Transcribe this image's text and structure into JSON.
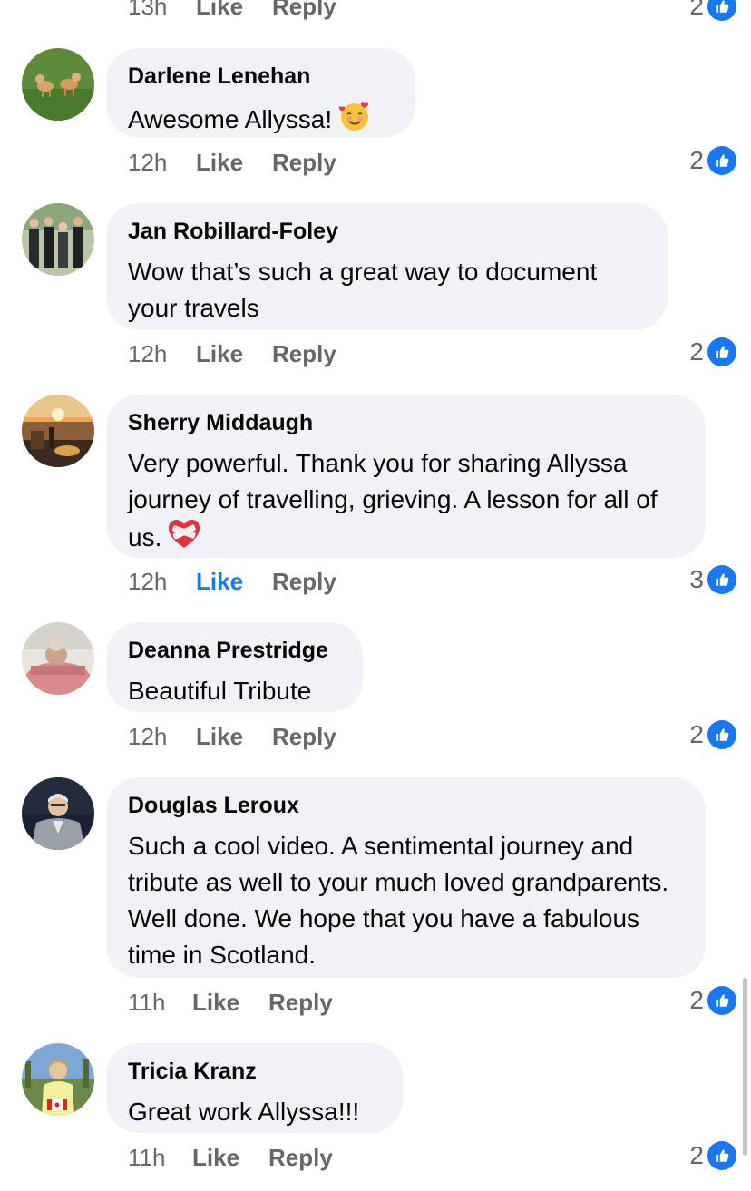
{
  "prev_meta": {
    "time": "13h",
    "like": "Like",
    "reply": "Reply",
    "count": "2"
  },
  "comments": [
    {
      "author": "Darlene Lenehan",
      "text": "Awesome Allyssa!",
      "emoji": "smiling-face-with-hearts-icon",
      "time": "12h",
      "like": "Like",
      "reply": "Reply",
      "count": "2",
      "liked": false
    },
    {
      "author": "Jan Robillard-Foley",
      "text": "Wow that’s such a great way to document your travels",
      "time": "12h",
      "like": "Like",
      "reply": "Reply",
      "count": "2",
      "liked": false
    },
    {
      "author": "Sherry Middaugh",
      "text": "Very powerful. Thank you for sharing Allyssa journey of travelling, grieving. A lesson for all of us.",
      "emoji": "mending-heart-icon",
      "time": "12h",
      "like": "Like",
      "reply": "Reply",
      "count": "3",
      "liked": true
    },
    {
      "author": "Deanna Prestridge",
      "text": "Beautiful Tribute",
      "time": "12h",
      "like": "Like",
      "reply": "Reply",
      "count": "2",
      "liked": false
    },
    {
      "author": "Douglas Leroux",
      "text": "Such a cool video. A sentimental journey and tribute as well to your much loved grandparents. Well done. We hope that you have a fabulous time in Scotland.",
      "time": "11h",
      "like": "Like",
      "reply": "Reply",
      "count": "2",
      "liked": false
    },
    {
      "author": "Tricia Kranz",
      "text": "Great work Allyssa!!!",
      "time": "11h",
      "like": "Like",
      "reply": "Reply",
      "count": "2",
      "liked": false
    }
  ],
  "colors": {
    "accent": "#1877f2",
    "bubble": "#f0f2f5",
    "meta": "#65676b"
  }
}
